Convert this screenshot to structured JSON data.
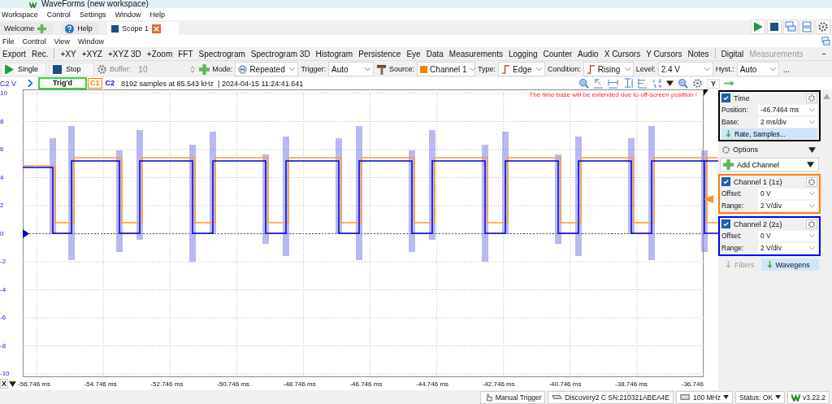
{
  "window": {
    "title": "WaveForms (new workspace)"
  },
  "menu": [
    "Workspace",
    "Control",
    "Settings",
    "Window",
    "Help"
  ],
  "tabs": [
    {
      "label": "Welcome",
      "selected": false,
      "kind": "add"
    },
    {
      "label": "Help",
      "selected": false,
      "kind": "help"
    },
    {
      "label": "Scope 1",
      "selected": true,
      "kind": "scope"
    }
  ],
  "scope_menu": [
    "File",
    "Control",
    "View",
    "Window"
  ],
  "toolbar": [
    {
      "label": "Export",
      "disabled": false
    },
    {
      "label": "Rec.",
      "disabled": false
    },
    {
      "label": "+XY",
      "disabled": false
    },
    {
      "label": "+XYZ",
      "disabled": false
    },
    {
      "label": "+XYZ 3D",
      "disabled": false
    },
    {
      "label": "+Zoom",
      "disabled": false
    },
    {
      "label": "FFT",
      "disabled": false
    },
    {
      "label": "Spectrogram",
      "disabled": false
    },
    {
      "label": "Spectrogram 3D",
      "disabled": false
    },
    {
      "label": "Histogram",
      "disabled": false
    },
    {
      "label": "Persistence",
      "disabled": false
    },
    {
      "label": "Eye",
      "disabled": false
    },
    {
      "label": "Data",
      "disabled": false
    },
    {
      "label": "Measurements",
      "disabled": false
    },
    {
      "label": "Logging",
      "disabled": false
    },
    {
      "label": "Counter",
      "disabled": false
    },
    {
      "label": "Audio",
      "disabled": false
    },
    {
      "label": "X Cursors",
      "disabled": false
    },
    {
      "label": "Y Cursors",
      "disabled": false
    },
    {
      "label": "Notes",
      "disabled": false
    },
    {
      "label": "Digital",
      "disabled": false
    },
    {
      "label": "Measurements",
      "disabled": true
    }
  ],
  "controls": [
    {
      "kind": "button",
      "label": "Single"
    },
    {
      "kind": "button",
      "label": "Stop"
    },
    {
      "kind": "icon"
    },
    {
      "kind": "spin",
      "label": "Buffer:",
      "value": "10",
      "disabled": true
    },
    {
      "kind": "icon"
    },
    {
      "kind": "select",
      "label": "Mode:",
      "value": "Repeated"
    },
    {
      "kind": "select",
      "label": "Trigger:",
      "value": "Auto"
    },
    {
      "kind": "icon"
    },
    {
      "kind": "select",
      "label": "Source:",
      "value": "Channel 1",
      "color": "#ff8000"
    },
    {
      "kind": "select",
      "label": "Type:",
      "value": "Edge"
    },
    {
      "kind": "select",
      "label": "Condition:",
      "value": "Rising"
    },
    {
      "kind": "select",
      "label": "Level:",
      "value": "2.4 V"
    },
    {
      "kind": "select",
      "label": "Hyst.:",
      "value": "Auto"
    },
    {
      "kind": "more",
      "label": "..."
    }
  ],
  "status_row": {
    "axis_unit": "C2 V",
    "trigger_state": "Trig'd",
    "channels": [
      {
        "label": "C1",
        "color": "#ff8000"
      },
      {
        "label": "C2",
        "color": "#0000ff"
      }
    ],
    "info": "8192 samples at 85.543 kHz  | 2024-04-15 11:24:41.641",
    "y_button": "Y"
  },
  "plot": {
    "warning": "The time base will be extended due to off-screen position !",
    "y_labels": [
      "10",
      "8",
      "6",
      "4",
      "2",
      "0",
      "-2",
      "-4",
      "-6",
      "-8",
      "-10"
    ],
    "x_button": "X",
    "x_labels": [
      "-56.746 ms",
      "-54.746 ms",
      "-52.746 ms",
      "-50.746 ms",
      "-48.746 ms",
      "-46.746 ms",
      "-44.746 ms",
      "-42.746 ms",
      "-40.746 ms",
      "-38.746 ms",
      "-36.746"
    ]
  },
  "panel": {
    "time": {
      "title": "Time",
      "checked": true,
      "fields": [
        {
          "label": "Position:",
          "value": "-46.7464 ms"
        },
        {
          "label": "Base:",
          "value": "2 ms/div"
        }
      ],
      "action": "Rate, Samples..."
    },
    "options": "Options",
    "add_channel": "Add Channel",
    "channels": [
      {
        "title": "Channel 1 (1±)",
        "checked": true,
        "color": "#ff8000",
        "fields": [
          {
            "label": "Offset:",
            "value": "0 V"
          },
          {
            "label": "Range:",
            "value": "2 V/div"
          }
        ]
      },
      {
        "title": "Channel 2 (2±)",
        "checked": true,
        "color": "#0000ff",
        "fields": [
          {
            "label": "Offset:",
            "value": "0 V"
          },
          {
            "label": "Range:",
            "value": "2 V/div"
          }
        ]
      }
    ],
    "bottom_tabs": [
      {
        "label": "Filters",
        "selected": false
      },
      {
        "label": "Wavegens",
        "selected": true
      }
    ]
  },
  "status_bar": [
    "Manual Trigger",
    "Discovery2 C SN:210321ABEA4E",
    "100 MHz",
    "Status: OK",
    "v3.22.2"
  ]
}
